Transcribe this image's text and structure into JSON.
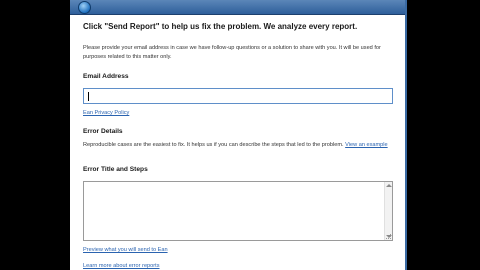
{
  "dialog": {
    "headline": "Click \"Send Report\" to help us fix the problem. We analyze every report.",
    "description": "Please provide your email address in case we have follow-up questions or a solution to share with you. It will be used for purposes related to this matter only.",
    "email_label": "Email Address",
    "email_value": "",
    "privacy_link": "Ean Privacy Policy",
    "error_details_label": "Error Details",
    "error_details_text": "Reproducible cases are the easiest to fix. It helps us if you can describe the steps that led to the problem.",
    "example_link": "View an example",
    "error_title_label": "Error Title and Steps",
    "error_title_value": "",
    "preview_link": "Preview what you will send to Ean",
    "learn_more_link": "Learn more about error reports"
  },
  "colors": {
    "link": "#2a63b0",
    "focus_border": "#5f8fc9",
    "title_bar": "#2e5f9b"
  },
  "icons": {
    "title": "app-globe-icon"
  }
}
